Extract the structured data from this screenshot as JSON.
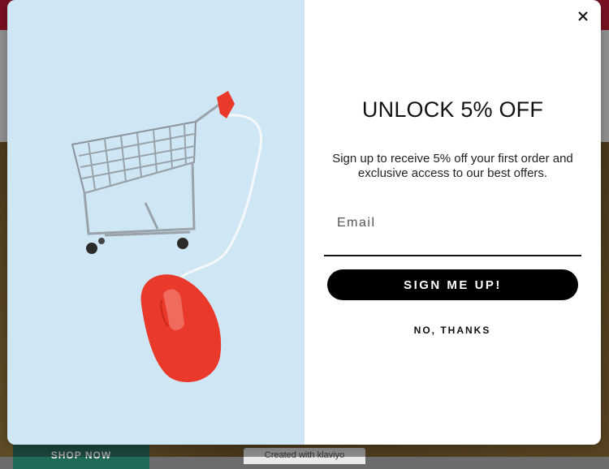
{
  "background": {
    "shop_button_label": "SHOP NOW",
    "created_with_label": "Created with klaviyo"
  },
  "modal": {
    "headline": "UNLOCK 5% OFF",
    "subtext": "Sign up to receive 5% off your first order and exclusive access to our best offers.",
    "email_placeholder": "Email",
    "email_value": "",
    "signup_label": "SIGN ME UP!",
    "decline_label": "NO, THANKS",
    "close_icon": "close-icon",
    "image_icons": [
      "shopping-cart-icon",
      "computer-mouse-icon"
    ]
  },
  "colors": {
    "top_bar": "#c8102e",
    "button_bg": "#000000",
    "image_bg": "#cfe7f4",
    "mouse": "#e8392a"
  }
}
